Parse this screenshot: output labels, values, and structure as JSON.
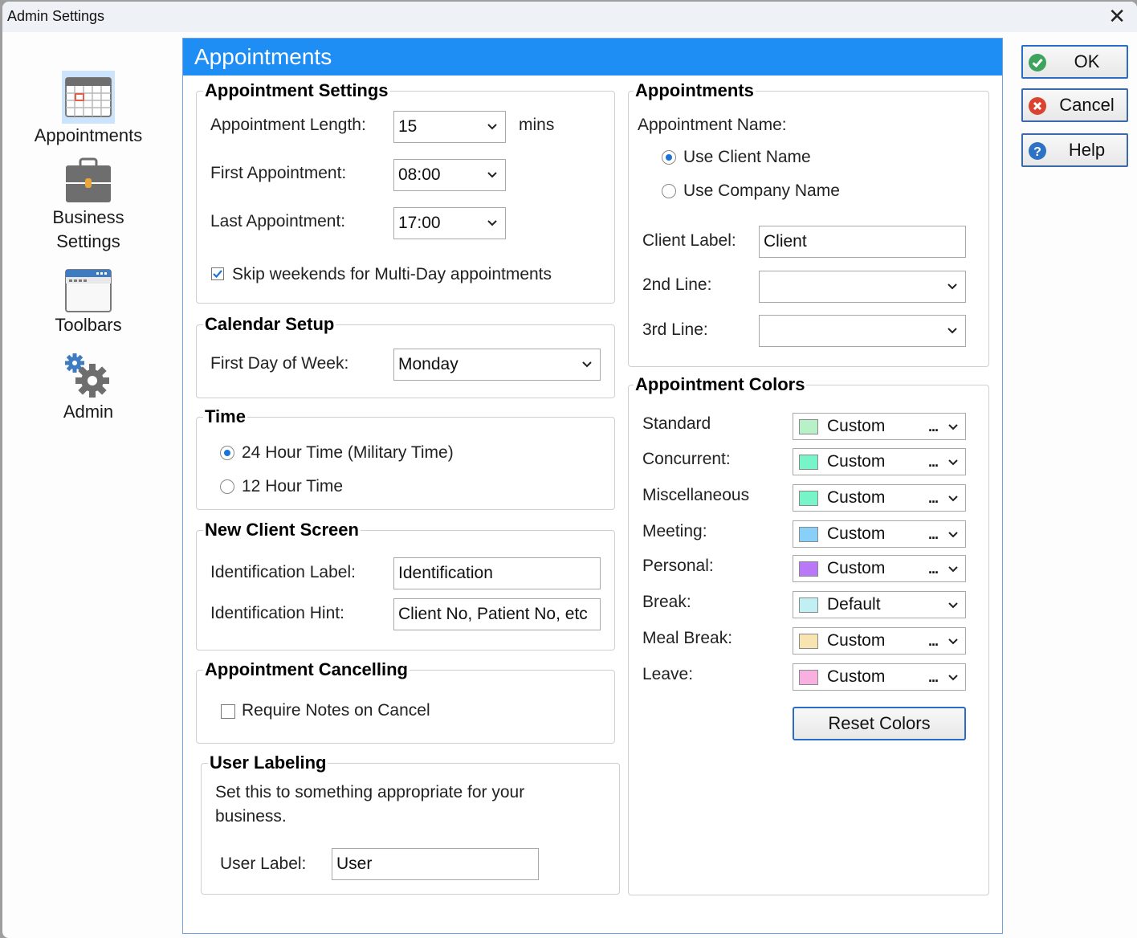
{
  "window": {
    "title": "Admin Settings",
    "close_icon": "close-icon"
  },
  "sidebar": {
    "items": [
      {
        "label": "Appointments",
        "icon": "calendar-icon",
        "selected": true
      },
      {
        "label": "Business Settings",
        "label_line1": "Business",
        "label_line2": "Settings",
        "icon": "briefcase-icon"
      },
      {
        "label": "Toolbars",
        "icon": "toolbar-window-icon"
      },
      {
        "label": "Admin",
        "icon": "gears-icon"
      }
    ]
  },
  "panel": {
    "title": "Appointments",
    "appointment_settings": {
      "title": "Appointment Settings",
      "length_label": "Appointment Length:",
      "length_value": "15",
      "length_unit": "mins",
      "first_label": "First Appointment:",
      "first_value": "08:00",
      "last_label": "Last Appointment:",
      "last_value": "17:00",
      "skip_weekends_label": "Skip weekends for Multi-Day appointments",
      "skip_weekends_checked": true
    },
    "calendar_setup": {
      "title": "Calendar Setup",
      "first_day_label": "First Day of Week:",
      "first_day_value": "Monday"
    },
    "time": {
      "title": "Time",
      "options": [
        {
          "label": "24 Hour Time (Military Time)",
          "selected": true
        },
        {
          "label": "12 Hour Time",
          "selected": false
        }
      ]
    },
    "new_client_screen": {
      "title": "New Client Screen",
      "id_label_label": "Identification Label:",
      "id_label_value": "Identification",
      "id_hint_label": "Identification Hint:",
      "id_hint_value": "Client No, Patient No, etc"
    },
    "appointment_cancelling": {
      "title": "Appointment Cancelling",
      "require_notes_label": "Require Notes on Cancel",
      "require_notes_checked": false
    },
    "user_labeling": {
      "title": "User Labeling",
      "description_line1": "Set this to something appropriate for your",
      "description_line2": "business.",
      "user_label_label": "User Label:",
      "user_label_value": "User"
    },
    "appointments": {
      "title": "Appointments",
      "name_label": "Appointment Name:",
      "name_options": [
        {
          "label": "Use Client Name",
          "selected": true
        },
        {
          "label": "Use Company Name",
          "selected": false
        }
      ],
      "client_label_label": "Client Label:",
      "client_label_value": "Client",
      "second_line_label": "2nd Line:",
      "second_line_value": "",
      "third_line_label": "3rd Line:",
      "third_line_value": ""
    },
    "appointment_colors": {
      "title": "Appointment Colors",
      "rows": [
        {
          "label": "Standard",
          "value": "Custom",
          "color": "#b8f0c8",
          "has_ellipsis": true
        },
        {
          "label": "Concurrent:",
          "value": "Custom",
          "color": "#78f5c8",
          "has_ellipsis": true
        },
        {
          "label": "Miscellaneous",
          "value": "Custom",
          "color": "#78f5c8",
          "has_ellipsis": true
        },
        {
          "label": "Meeting:",
          "value": "Custom",
          "color": "#88d0f8",
          "has_ellipsis": true
        },
        {
          "label": "Personal:",
          "value": "Custom",
          "color": "#b878f8",
          "has_ellipsis": true
        },
        {
          "label": "Break:",
          "value": "Default",
          "color": "#c0f0f4",
          "has_ellipsis": false
        },
        {
          "label": "Meal Break:",
          "value": "Custom",
          "color": "#f8e4b0",
          "has_ellipsis": true
        },
        {
          "label": "Leave:",
          "value": "Custom",
          "color": "#f8b0e0",
          "has_ellipsis": true
        }
      ],
      "ellipsis": "...",
      "reset_label": "Reset Colors"
    }
  },
  "buttons": {
    "ok": "OK",
    "cancel": "Cancel",
    "help": "Help"
  },
  "colors": {
    "header_blue": "#1e8ef5",
    "ok_green": "#3da35d",
    "cancel_red": "#d9432f",
    "help_blue": "#2d72c4"
  }
}
